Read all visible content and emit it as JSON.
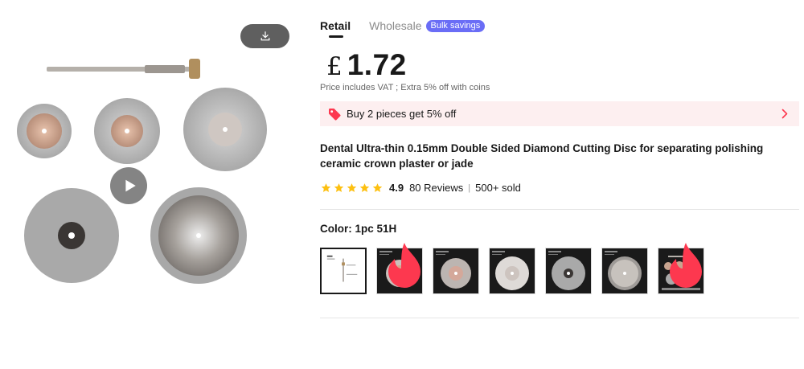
{
  "gallery": {
    "download_icon": "download-icon",
    "play_icon": "play-icon"
  },
  "tabs": {
    "retail": "Retail",
    "wholesale": "Wholesale",
    "bulk_badge": "Bulk savings"
  },
  "price": {
    "currency": "£",
    "value": "1.72",
    "note": "Price includes VAT ; Extra 5% off with coins"
  },
  "promo": {
    "icon": "tag-icon",
    "text": "Buy 2 pieces get 5% off",
    "chevron": "chevron-right-icon"
  },
  "product": {
    "title": "Dental Ultra-thin 0.15mm Double Sided Diamond Cutting Disc for separating polishing ceramic crown plaster or jade"
  },
  "rating": {
    "stars": 5,
    "value": "4.9",
    "reviews": "80 Reviews",
    "separator": "|",
    "sold": "500+ sold"
  },
  "color": {
    "label": "Color: 1pc 51H",
    "options": [
      {
        "name": "1pc 51H",
        "selected": true,
        "hot": false
      },
      {
        "name": "option-2",
        "selected": false,
        "hot": true
      },
      {
        "name": "option-3",
        "selected": false,
        "hot": false
      },
      {
        "name": "option-4",
        "selected": false,
        "hot": false
      },
      {
        "name": "option-5",
        "selected": false,
        "hot": false
      },
      {
        "name": "option-6",
        "selected": false,
        "hot": false
      },
      {
        "name": "option-7",
        "selected": false,
        "hot": true
      }
    ]
  },
  "colors": {
    "accent_red": "#fd384f",
    "badge_purple": "#6a6df6",
    "promo_bg": "#fdeff0",
    "star_yellow": "#fdc011"
  }
}
